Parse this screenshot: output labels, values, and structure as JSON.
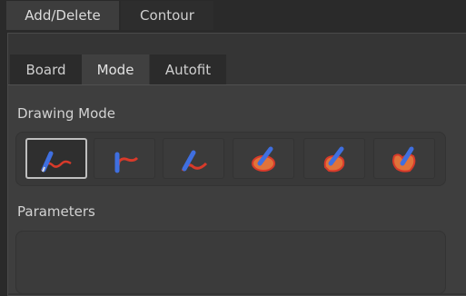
{
  "outer_tabs": [
    {
      "label": "Add/Delete",
      "selected": true
    },
    {
      "label": "Contour",
      "selected": false
    }
  ],
  "inner_tabs": [
    {
      "label": "Board",
      "selected": false
    },
    {
      "label": "Mode",
      "selected": true
    },
    {
      "label": "Autofit",
      "selected": false
    }
  ],
  "drawing_mode": {
    "label": "Drawing Mode",
    "buttons": [
      {
        "icon": "pen-freehand-icon",
        "selected": true
      },
      {
        "icon": "pen-open-contour-icon",
        "selected": false
      },
      {
        "icon": "pen-curve-icon",
        "selected": false
      },
      {
        "icon": "pen-filled-blob-icon",
        "selected": false
      },
      {
        "icon": "pen-filled-region-icon",
        "selected": false
      },
      {
        "icon": "pen-filled-shape-icon",
        "selected": false
      }
    ]
  },
  "parameters": {
    "label": "Parameters"
  },
  "colors": {
    "pen_blue": "#3f6fe0",
    "stroke_red": "#d83a2a",
    "fill_orange": "#e0733a"
  }
}
